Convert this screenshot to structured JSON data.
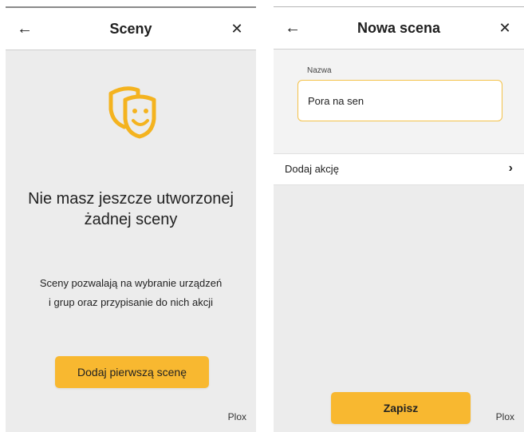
{
  "scenes_screen": {
    "title": "Sceny",
    "back_icon": "arrow-left-icon",
    "close_icon": "close-icon",
    "empty_icon": "theater-masks-icon",
    "empty_title": "Nie masz jeszcze utworzonej żadnej sceny",
    "empty_description_line1": "Sceny pozwalają na wybranie urządzeń",
    "empty_description_line2": "i grup oraz przypisanie do nich akcji",
    "add_first_button": "Dodaj pierwszą scenę",
    "brand": "Plox"
  },
  "new_scene_screen": {
    "title": "Nowa scena",
    "back_icon": "arrow-left-icon",
    "close_icon": "close-icon",
    "name_label": "Nazwa",
    "name_value": "Pora na sen",
    "add_action_label": "Dodaj akcję",
    "add_action_icon": "chevron-right-icon",
    "save_button": "Zapisz",
    "brand": "Plox"
  },
  "colors": {
    "accent": "#f8b830",
    "input_border": "#f4c24a",
    "screen_background": "#ececec",
    "header_background": "#ffffff"
  }
}
